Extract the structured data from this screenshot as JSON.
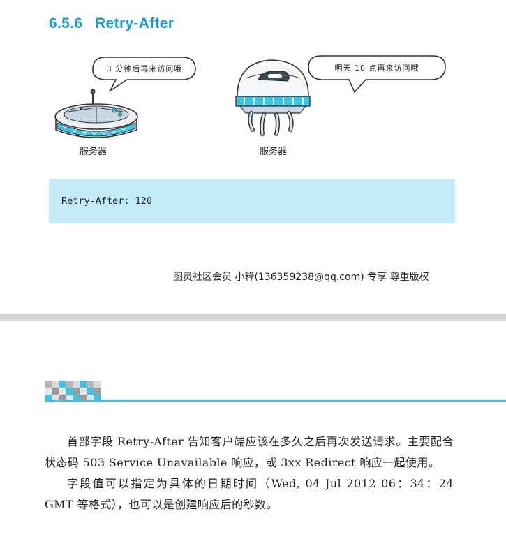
{
  "section": {
    "number": "6.5.6",
    "title": "Retry-After"
  },
  "illustration": {
    "left_bubble": "3 分钟后再来访问哦",
    "right_bubble": "明天 10 点再来访问哦",
    "left_caption": "服务器",
    "right_caption": "服务器"
  },
  "code_example": "Retry-After: 120",
  "watermark": "图灵社区会员 小释(136359238@qq.com) 专享 尊重版权",
  "paragraphs": [
    "首部字段 Retry-After 告知客户端应该在多久之后再次发送请求。主要配合状态码 503 Service Unavailable 响应，或 3xx Redirect 响应一起使用。",
    "字段值可以指定为具体的日期时间（Wed, 04 Jul 2012 06：34：24 GMT 等格式），也可以是创建响应后的秒数。"
  ],
  "colors": {
    "heading": "#1b9ad6",
    "code_background": "#c3ecf8",
    "accent": "#3cc3e6"
  }
}
